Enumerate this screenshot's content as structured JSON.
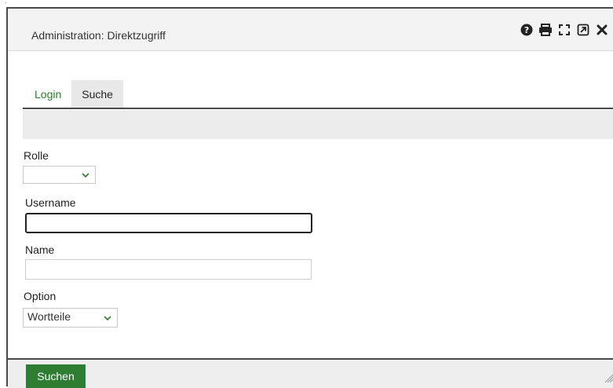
{
  "window": {
    "title": "Administration: Direktzugriff"
  },
  "titlebar_icons": [
    "help-icon",
    "print-icon",
    "fullscreen-icon",
    "popout-icon",
    "close-icon"
  ],
  "tabs": [
    {
      "label": "Login",
      "active": true
    },
    {
      "label": "Suche",
      "active": false
    }
  ],
  "form": {
    "rolle": {
      "label": "Rolle",
      "value": ""
    },
    "username": {
      "label": "Username",
      "value": ""
    },
    "name": {
      "label": "Name",
      "value": ""
    },
    "option": {
      "label": "Option",
      "value": "Wortteile"
    }
  },
  "footer": {
    "search_button": "Suchen"
  },
  "colors": {
    "accent": "#2e7d32",
    "border": "#4a4a4a",
    "bar": "#ececec"
  }
}
